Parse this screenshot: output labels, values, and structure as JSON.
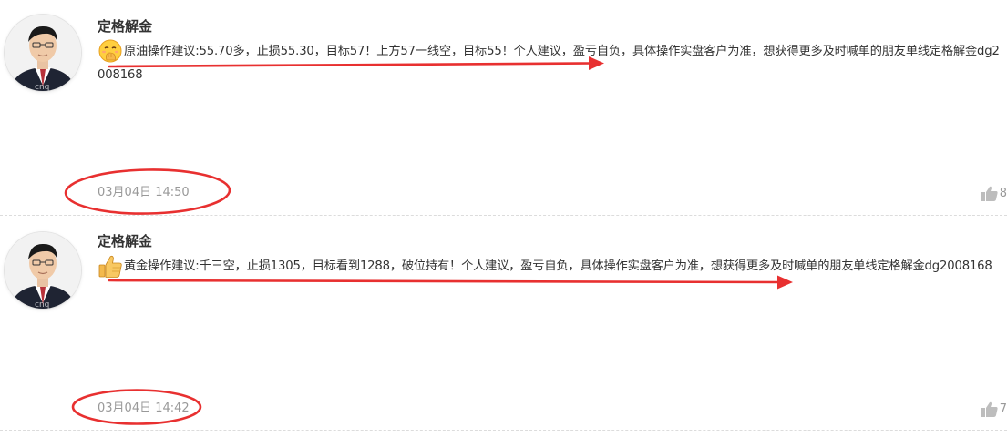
{
  "posts": [
    {
      "author": "定格解金",
      "emoji": "face-with-hand-over-mouth-icon",
      "content": "原油操作建议:55.70多，止损55.30，目标57！上方57一线空，目标55！个人建议，盈亏自负，具体操作实盘客户为准，想获得更多及时喊单的朋友单线定格解金dg2008168",
      "timestamp": "03月04日 14:50",
      "likes": "8"
    },
    {
      "author": "定格解金",
      "emoji": "thumbs-up-icon",
      "content": "黄金操作建议:千三空，止损1305，目标看到1288，破位持有！个人建议，盈亏自负，具体操作实盘客户为准，想获得更多及时喊单的朋友单线定格解金dg2008168",
      "timestamp": "03月04日 14:42",
      "likes": "7"
    }
  ],
  "colors": {
    "annotation_red": "#e83030",
    "author_text": "#333333",
    "muted_text": "#999999",
    "divider": "#dcdcdc"
  }
}
